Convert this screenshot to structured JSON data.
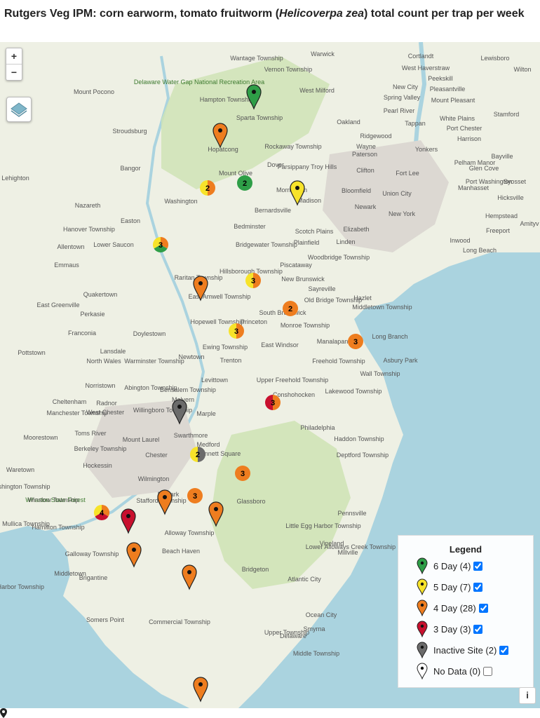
{
  "title": {
    "prefix": "Rutgers Veg IPM: corn earworm, tomato fruitworm (",
    "italic": "Helicoverpa zea",
    "suffix": ") total count per trap per week"
  },
  "zoom": {
    "in": "+",
    "out": "−"
  },
  "colors": {
    "water": "#aad3df",
    "land": "#eef0e4",
    "forest": "#cfe3b6",
    "urban": "#dcd8d2",
    "green": "#2e9e47",
    "yellow": "#f7e32a",
    "orange": "#ee7d1f",
    "red": "#c8102e",
    "gray": "#6b6b6b",
    "white": "#ffffff"
  },
  "map_labels": [
    "Warwick",
    "Wantage Township",
    "Vernon Township",
    "Cortlandt",
    "Lewisboro",
    "Wilton",
    "West Haverstraw",
    "Peekskill",
    "Delaware Water Gap National Recreation Area",
    "Mount Pocono",
    "Hampton Township",
    "West Milford",
    "New City",
    "Pleasantville",
    "Spring Valley",
    "Mount Pleasant",
    "Sparta Township",
    "Pearl River",
    "Stamford",
    "Oakland",
    "Tappan",
    "White Plains",
    "Port Chester",
    "Stroudsburg",
    "Ridgewood",
    "Harrison",
    "Hopatcong",
    "Rockaway Township",
    "Wayne",
    "Paterson",
    "Yonkers",
    "Bayville",
    "Bangor",
    "Dover",
    "Parsippany Troy Hills",
    "Pelham Manor",
    "Lehighton",
    "Clifton",
    "Fort Lee",
    "Glen Cove",
    "Mount Olive",
    "Port Washington",
    "Syosset",
    "Washington",
    "Morristown",
    "Madison",
    "Bloomfield",
    "Union City",
    "Manhasset",
    "Hicksville",
    "Nazareth",
    "Bernardsville",
    "Newark",
    "New York",
    "Hanover Township",
    "Easton",
    "Bedminster",
    "Scotch Plains",
    "Elizabeth",
    "Hempstead",
    "Amityv",
    "Freeport",
    "Allentown",
    "Lower Saucon",
    "Plainfield",
    "Linden",
    "Bridgewater Township",
    "Inwood",
    "Long Beach",
    "Emmaus",
    "Piscataway",
    "Woodbridge Township",
    "Raritan Township",
    "Hillsborough Township",
    "New Brunswick",
    "Sayreville",
    "Quakertown",
    "East Amwell Township",
    "Old Bridge Township",
    "Hazlet",
    "Middletown Township",
    "East Greenville",
    "Perkasie",
    "South Brunswick",
    "Hopewell Township",
    "Princeton",
    "Monroe Township",
    "Franconia",
    "Doylestown",
    "Manalapan",
    "Long Branch",
    "Ewing Township",
    "East Windsor",
    "Pottstown",
    "Lansdale",
    "North Wales",
    "Warminster Township",
    "Newtown",
    "Trenton",
    "Freehold Township",
    "Asbury Park",
    "Wall Township",
    "Levittown",
    "Upper Freehold Township",
    "Norristown",
    "Abington Township",
    "Bensalem Township",
    "Lakewood Township",
    "Conshohocken",
    "Cheltenham",
    "Malvern",
    "Radnor",
    "Willingboro Township",
    "Manchester Township",
    "West Chester",
    "Marple",
    "Philadelphia",
    "Moorestown",
    "Toms River",
    "Mount Laurel",
    "Swarthmore",
    "Haddon Township",
    "Medford",
    "Berkeley Township",
    "Chester",
    "Kennett Square",
    "Deptford Township",
    "Hockessin",
    "Waretown",
    "Wilmington",
    "Washington Township",
    "Wharton State Forest",
    "Newark",
    "Glassboro",
    "Stafford Township",
    "Pennsville",
    "Winslow Township",
    "Little Egg Harbor Township",
    "Alloway Township",
    "Mullica Township",
    "Beach Haven",
    "Lower Alloways Creek Township",
    "Hamilton Township",
    "Vineland",
    "Galloway Township",
    "Middletown",
    "Bridgeton",
    "Brigantine",
    "Millville",
    "Egg Harbor Township",
    "Atlantic City",
    "Somers Point",
    "Smyrna",
    "Commercial Township",
    "Ocean City",
    "Upper Township",
    "Delaware",
    "Middle Township"
  ],
  "markers": [
    {
      "name": "Sparta Township site",
      "status": "6 Day",
      "color": "green"
    },
    {
      "name": "Hopatcong site",
      "status": "4 Day",
      "color": "orange"
    },
    {
      "name": "Madison site",
      "status": "5 Day",
      "color": "yellow"
    },
    {
      "name": "Raritan Township site",
      "status": "4 Day",
      "color": "orange"
    },
    {
      "name": "Willingboro site",
      "status": "Inactive Site",
      "color": "gray"
    },
    {
      "name": "Washington Township site",
      "status": "4 Day",
      "color": "orange"
    },
    {
      "name": "Glassboro site",
      "status": "3 Day",
      "color": "red"
    },
    {
      "name": "Winslow Township site",
      "status": "4 Day",
      "color": "orange"
    },
    {
      "name": "Alloway Township site",
      "status": "4 Day",
      "color": "orange"
    },
    {
      "name": "Vineland site",
      "status": "4 Day",
      "color": "orange"
    },
    {
      "name": "Middle Township site",
      "status": "4 Day",
      "color": "orange"
    }
  ],
  "clusters": [
    {
      "count": "2",
      "colors": [
        "green"
      ]
    },
    {
      "count": "2",
      "colors": [
        "orange",
        "yellow"
      ]
    },
    {
      "count": "3",
      "colors": [
        "orange",
        "green",
        "yellow"
      ]
    },
    {
      "count": "3",
      "colors": [
        "orange",
        "yellow"
      ]
    },
    {
      "count": "2",
      "colors": [
        "orange"
      ]
    },
    {
      "count": "3",
      "colors": [
        "orange",
        "yellow"
      ]
    },
    {
      "count": "3",
      "colors": [
        "orange"
      ]
    },
    {
      "count": "3",
      "colors": [
        "orange",
        "red"
      ]
    },
    {
      "count": "2",
      "colors": [
        "gray",
        "yellow"
      ]
    },
    {
      "count": "3",
      "colors": [
        "orange"
      ]
    },
    {
      "count": "3",
      "colors": [
        "orange"
      ]
    },
    {
      "count": "4",
      "colors": [
        "orange",
        "red",
        "yellow"
      ]
    }
  ],
  "legend": {
    "title": "Legend",
    "items": [
      {
        "label": "6 Day (4)",
        "color": "green",
        "checked": true
      },
      {
        "label": "5 Day (7)",
        "color": "yellow",
        "checked": true
      },
      {
        "label": "4 Day (28)",
        "color": "orange",
        "checked": true
      },
      {
        "label": "3 Day (3)",
        "color": "red",
        "checked": true
      },
      {
        "label": "Inactive Site (2)",
        "color": "gray",
        "checked": true
      },
      {
        "label": "No Data (0)",
        "color": "white",
        "checked": false
      }
    ]
  },
  "info_button": "i"
}
